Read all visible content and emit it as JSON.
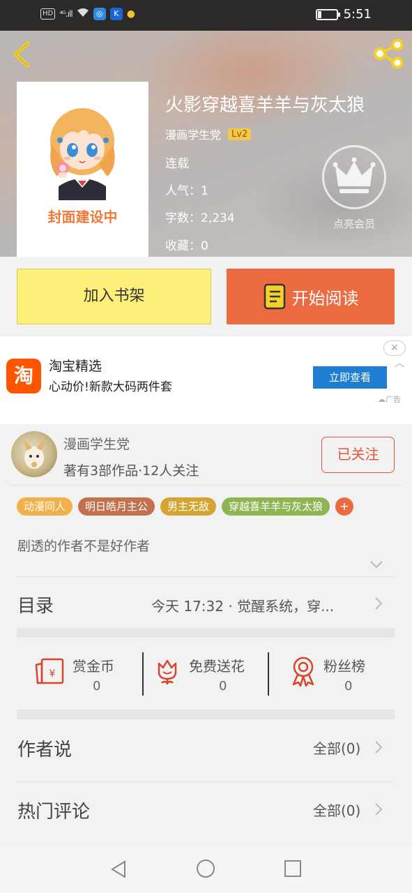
{
  "status_bar": {
    "network": "HD",
    "signal": "⁴ᴳ.ıll",
    "time": "5:51",
    "battery_level": 0.18
  },
  "book": {
    "title": "火影穿越喜羊羊与灰太狼",
    "cover_text": "封面建设中",
    "author": "漫画学生党",
    "level": "Lv2",
    "status": "连载",
    "popularity": "人气：1",
    "word_count": "字数：2,234",
    "favorites": "收藏：0",
    "vip_label": "点亮会员"
  },
  "actions": {
    "add_shelf": "加入书架",
    "start_reading": "开始阅读"
  },
  "ad": {
    "logo_text": "淘",
    "title": "淘宝精选",
    "subtitle": "心动价!新款大码两件套",
    "button": "立即查看",
    "mark": "广告",
    "close": "✕"
  },
  "author_card": {
    "name": "漫画学生党",
    "stats": "著有3部作品·12人关注",
    "follow": "已关注",
    "tags": [
      {
        "label": "动漫同人",
        "color": "#f2b04a"
      },
      {
        "label": "明日皓月主公",
        "color": "#c2714e"
      },
      {
        "label": "男主无敌",
        "color": "#d4a533"
      },
      {
        "label": "穿越喜羊羊与灰太狼",
        "color": "#8fb552"
      }
    ],
    "tag_more": "+",
    "description": "剧透的作者不是好作者"
  },
  "toc": {
    "title": "目录",
    "latest": "今天 17:32 · 觉醒系统，穿..."
  },
  "rewards": [
    {
      "label": "赏金币",
      "value": "0",
      "icon": "red-envelope-icon"
    },
    {
      "label": "免费送花",
      "value": "0",
      "icon": "flower-icon"
    },
    {
      "label": "粉丝榜",
      "value": "0",
      "icon": "medal-icon"
    }
  ],
  "author_says": {
    "title": "作者说",
    "link": "全部(0)"
  },
  "hot_comments": {
    "title": "热门评论",
    "link": "全部(0)"
  },
  "colors": {
    "accent": "#ec6a3f",
    "shelf_button": "#fdf07a",
    "ad_button": "#1e7ed2",
    "icon_red": "#d8442c"
  }
}
